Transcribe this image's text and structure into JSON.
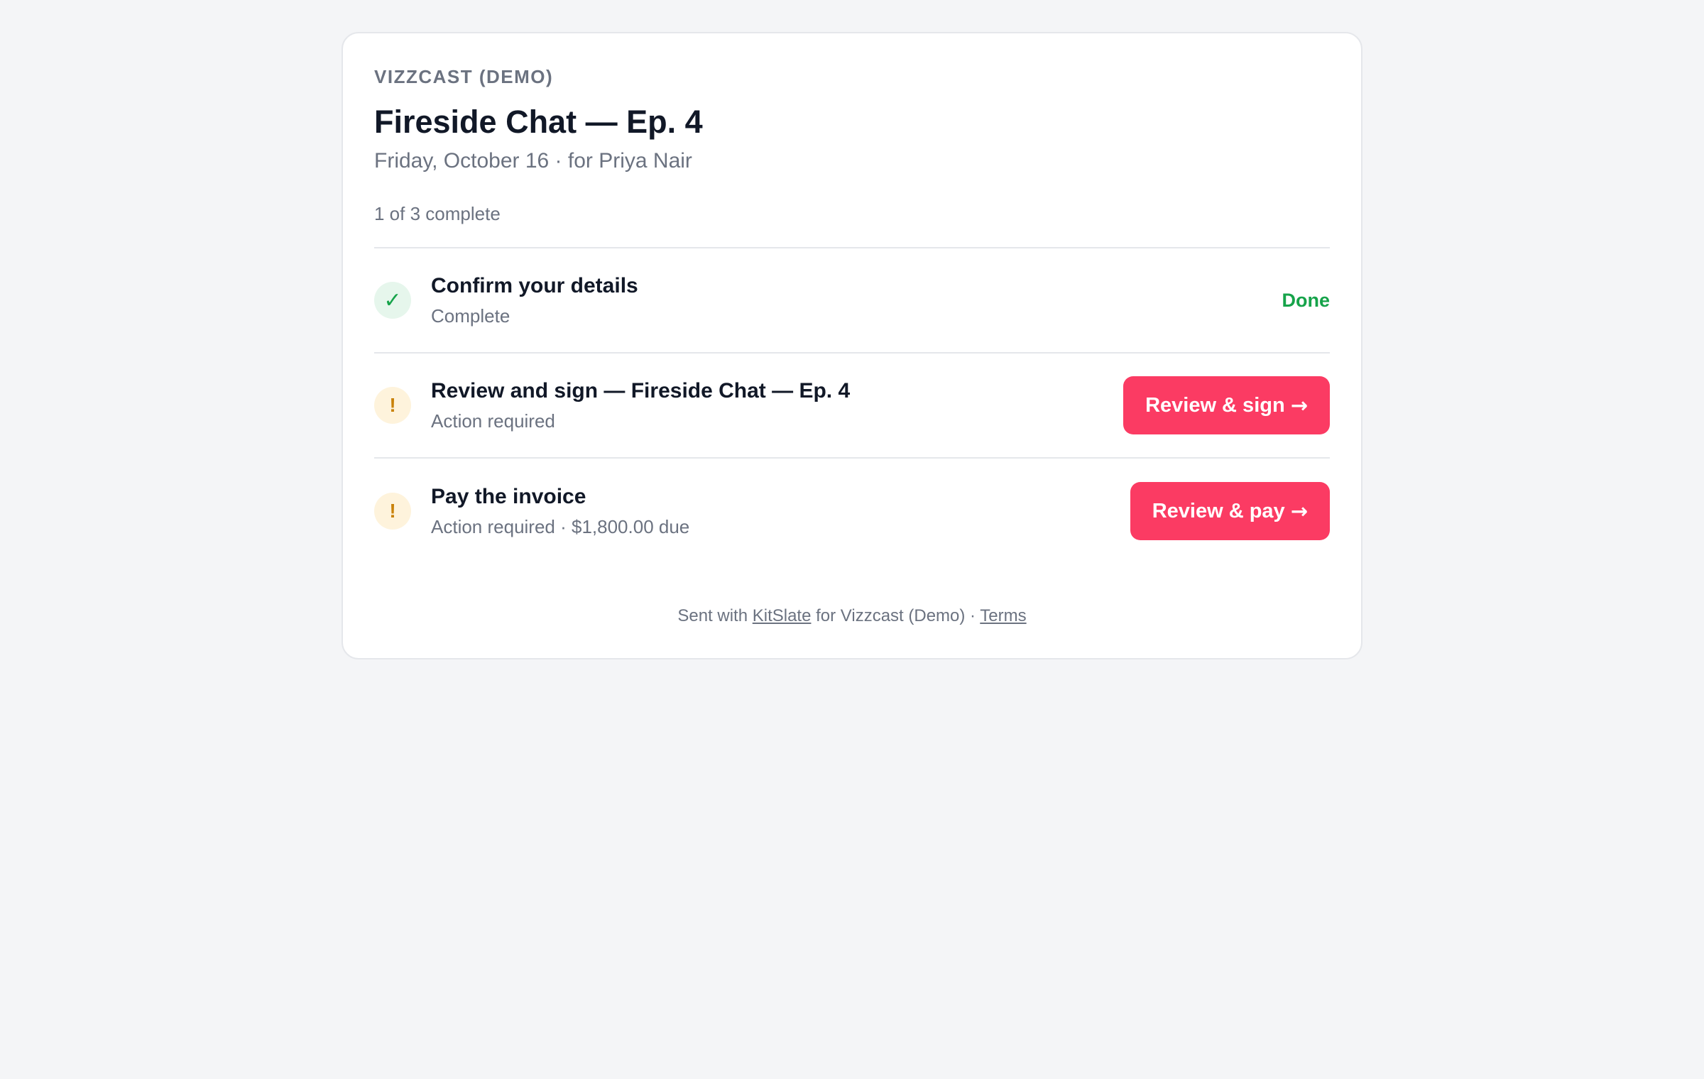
{
  "header": {
    "org": "VIZZCAST (DEMO)",
    "title": "Fireside Chat — Ep. 4",
    "subtitle": "Friday, October 16 · for Priya Nair",
    "progress": "1 of 3 complete"
  },
  "tasks": [
    {
      "icon": "check-icon",
      "icon_glyph": "✓",
      "title": "Confirm your details",
      "subtitle": "Complete",
      "status_label": "Done"
    },
    {
      "icon": "alert-icon",
      "icon_glyph": "!",
      "title": "Review and sign — Fireside Chat — Ep. 4",
      "subtitle": "Action required",
      "button_label": "Review & sign",
      "button_arrow": "→"
    },
    {
      "icon": "alert-icon",
      "icon_glyph": "!",
      "title": "Pay the invoice",
      "subtitle": "Action required · $1,800.00 due",
      "button_label": "Review & pay",
      "button_arrow": "→"
    }
  ],
  "footer": {
    "prefix": "Sent with ",
    "brand_link": "KitSlate",
    "middle": " for Vizzcast (Demo) · ",
    "terms_link": "Terms"
  },
  "colors": {
    "accent": "#fb3b63",
    "success": "#16a34a",
    "warning": "#c9820a",
    "background": "#f4f5f7"
  }
}
